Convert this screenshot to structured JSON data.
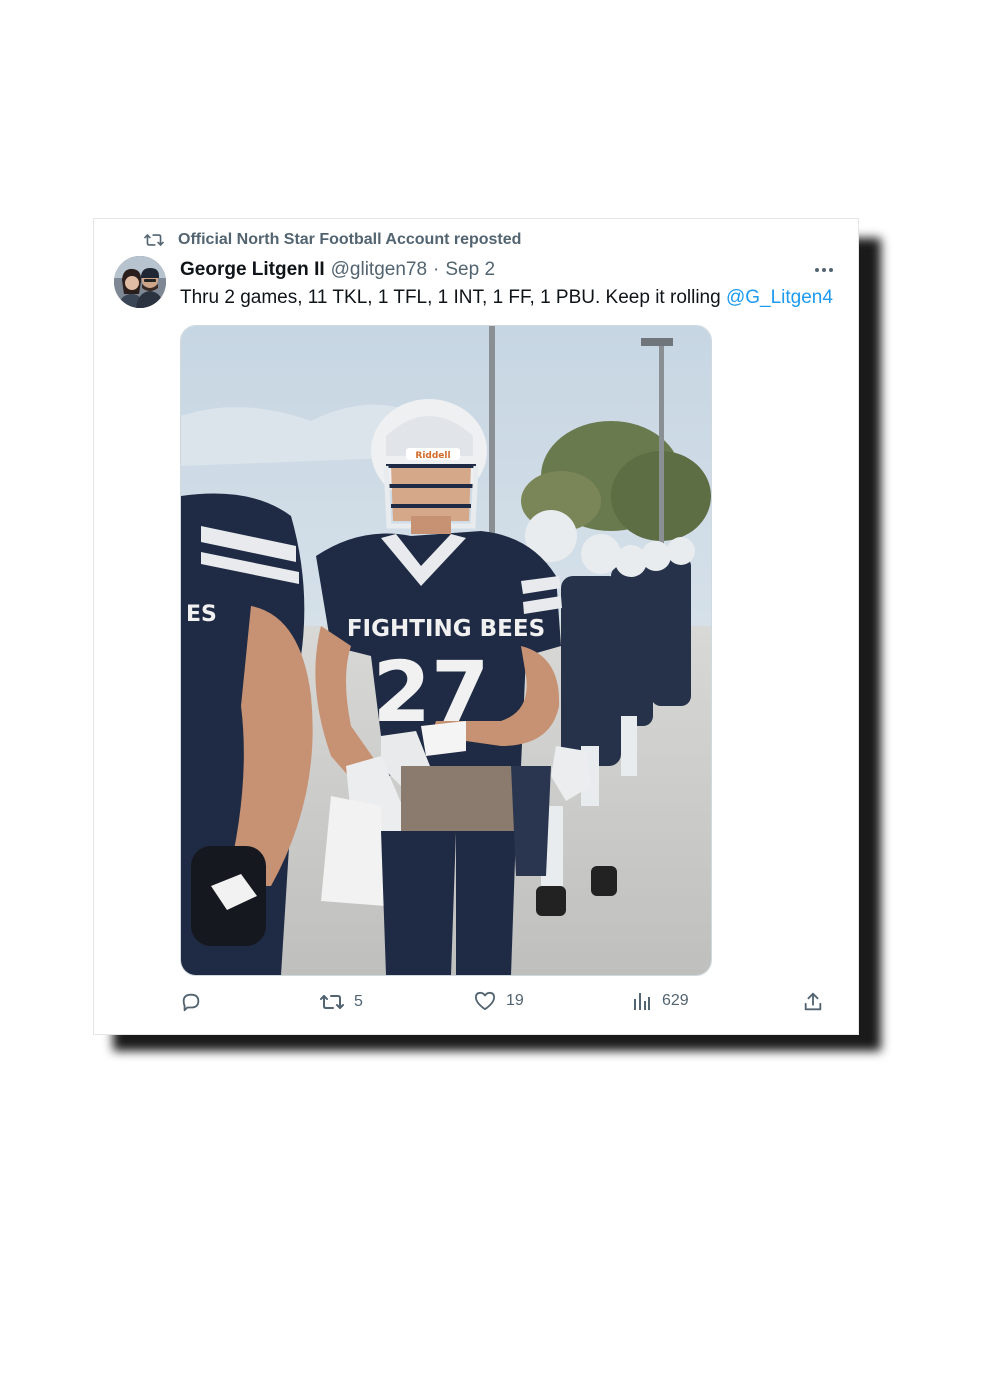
{
  "repost": {
    "label": "Official North Star Football Account reposted",
    "icon": "repost-icon"
  },
  "tweet": {
    "display_name": "George Litgen II",
    "handle": "@glitgen78",
    "separator": "·",
    "date": "Sep 2",
    "text": "Thru 2 games, 11 TKL, 1 TFL, 1 INT, 1 FF, 1 PBU. Keep it rolling",
    "mention": "@G_Litgen4",
    "more_icon": "more-dots-icon",
    "image": {
      "jersey_text": "FIGHTING BEES",
      "jersey_number": "27",
      "helmet_brand": "Riddell",
      "sleeve_text": "ES"
    }
  },
  "actions": {
    "reply": {
      "icon": "reply-icon",
      "count": ""
    },
    "repost": {
      "icon": "repost-icon",
      "count": "5"
    },
    "like": {
      "icon": "heart-icon",
      "count": "19"
    },
    "views": {
      "icon": "analytics-icon",
      "count": "629"
    },
    "share": {
      "icon": "share-icon"
    }
  },
  "colors": {
    "text": "#0f1419",
    "muted": "#536471",
    "link": "#1d9bf0",
    "jersey_navy": "#1f2b44"
  }
}
